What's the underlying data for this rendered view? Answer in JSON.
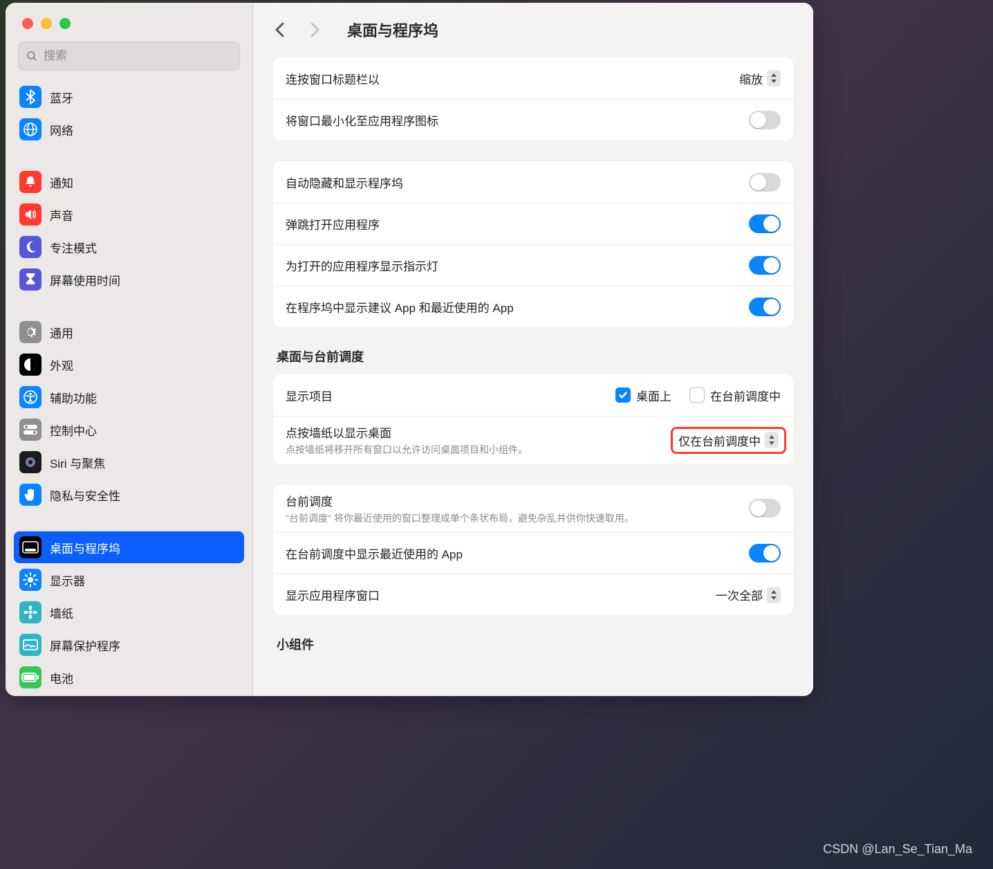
{
  "header": {
    "title": "桌面与程序坞"
  },
  "search": {
    "placeholder": "搜索"
  },
  "sidebar": [
    {
      "id": "bluetooth",
      "label": "蓝牙",
      "icon": "bluetooth-icon",
      "bg": "#0a84ff"
    },
    {
      "id": "network",
      "label": "网络",
      "icon": "globe-icon",
      "bg": "#0a84ff"
    },
    {
      "gap": true
    },
    {
      "id": "notifications",
      "label": "通知",
      "icon": "bell-icon",
      "bg": "#ff3b30"
    },
    {
      "id": "sound",
      "label": "声音",
      "icon": "speaker-icon",
      "bg": "#ff3b30"
    },
    {
      "id": "focus",
      "label": "专注模式",
      "icon": "moon-icon",
      "bg": "#5856d6"
    },
    {
      "id": "screentime",
      "label": "屏幕使用时间",
      "icon": "hourglass-icon",
      "bg": "#5856d6"
    },
    {
      "gap": true
    },
    {
      "id": "general",
      "label": "通用",
      "icon": "gear-icon",
      "bg": "#8e8e93"
    },
    {
      "id": "appearance",
      "label": "外观",
      "icon": "appearance-icon",
      "bg": "#000000"
    },
    {
      "id": "accessibility",
      "label": "辅助功能",
      "icon": "accessibility-icon",
      "bg": "#0a84ff"
    },
    {
      "id": "controlcenter",
      "label": "控制中心",
      "icon": "switches-icon",
      "bg": "#8e8e93"
    },
    {
      "id": "siri",
      "label": "Siri 与聚焦",
      "icon": "siri-icon",
      "bg": "#1b1b1b"
    },
    {
      "id": "privacy",
      "label": "隐私与安全性",
      "icon": "hand-icon",
      "bg": "#0a84ff"
    },
    {
      "gap": true
    },
    {
      "id": "dock",
      "label": "桌面与程序坞",
      "icon": "dock-icon",
      "bg": "#000000",
      "selected": true
    },
    {
      "id": "displays",
      "label": "显示器",
      "icon": "sun-icon",
      "bg": "#0a84ff"
    },
    {
      "id": "wallpaper",
      "label": "墙纸",
      "icon": "flower-icon",
      "bg": "#2fb4c6"
    },
    {
      "id": "screensaver",
      "label": "屏幕保护程序",
      "icon": "screensaver-icon",
      "bg": "#2fb4c6"
    },
    {
      "id": "battery",
      "label": "电池",
      "icon": "battery-icon",
      "bg": "#34c759"
    }
  ],
  "group1": {
    "doubleClickTitle": "连按窗口标题栏以",
    "doubleClickValue": "缩放",
    "minimizeToIcon": "将窗口最小化至应用程序图标"
  },
  "group2": {
    "autoHide": "自动隐藏和显示程序坞",
    "bounce": "弹跳打开应用程序",
    "indicator": "为打开的应用程序显示指示灯",
    "recent": "在程序坞中显示建议 App 和最近使用的 App"
  },
  "stage": {
    "sectionTitle": "桌面与台前调度",
    "showItems": "显示项目",
    "onDesktop": "桌面上",
    "inStageManager": "在台前调度中",
    "clickWallpaperTitle": "点按墙纸以显示桌面",
    "clickWallpaperSub": "点按墙纸将移开所有窗口以允许访问桌面项目和小组件。",
    "clickWallpaperValue": "仅在台前调度中",
    "stageManagerTitle": "台前调度",
    "stageManagerSub": "\"台前调度\" 将你最近使用的窗口整理成单个条状布局，避免杂乱并供你快速取用。",
    "showRecentInStage": "在台前调度中显示最近使用的 App",
    "showAppWindowsTitle": "显示应用程序窗口",
    "showAppWindowsValue": "一次全部"
  },
  "widgets": {
    "sectionTitle": "小组件"
  },
  "watermark": "CSDN @Lan_Se_Tian_Ma"
}
